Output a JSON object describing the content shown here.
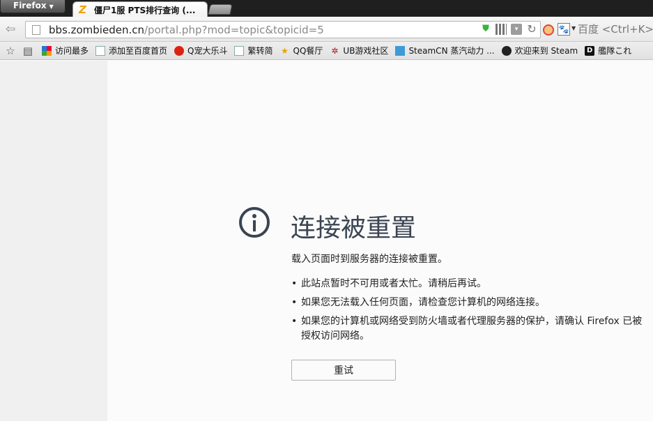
{
  "browser": {
    "menu_label": "Firefox",
    "tab_title": "僵尸1服 PTS排行查询 (...",
    "tab_favicon": "zombieden-z-icon"
  },
  "navbar": {
    "url_domain": "bbs.zombieden.cn",
    "url_path": "/portal.php?mod=topic&topicid=5",
    "search_placeholder": "百度 <Ctrl+K>"
  },
  "bookmarks": [
    {
      "label": "访问最多",
      "icon": "grid-icon"
    },
    {
      "label": "添加至百度首页",
      "icon": "page-icon"
    },
    {
      "label": "Q宠大乐斗",
      "icon": "qq-pet-icon"
    },
    {
      "label": "繁转简",
      "icon": "page-icon"
    },
    {
      "label": "QQ餐厅",
      "icon": "star-icon"
    },
    {
      "label": "UB游戏社区",
      "icon": "ub-icon"
    },
    {
      "label": "SteamCN 蒸汽动力 ...",
      "icon": "steamcn-icon"
    },
    {
      "label": "欢迎来到 Steam",
      "icon": "steam-icon"
    },
    {
      "label": "艦隊これ",
      "icon": "d-icon"
    }
  ],
  "error": {
    "title": "连接被重置",
    "description": "载入页面时到服务器的连接被重置。",
    "items": [
      "此站点暂时不可用或者太忙。请稍后再试。",
      "如果您无法载入任何页面，请检查您计算机的网络连接。",
      "如果您的计算机或网络受到防火墙或者代理服务器的保护，请确认 Firefox 已被授权访问网络。"
    ],
    "retry_label": "重试"
  }
}
